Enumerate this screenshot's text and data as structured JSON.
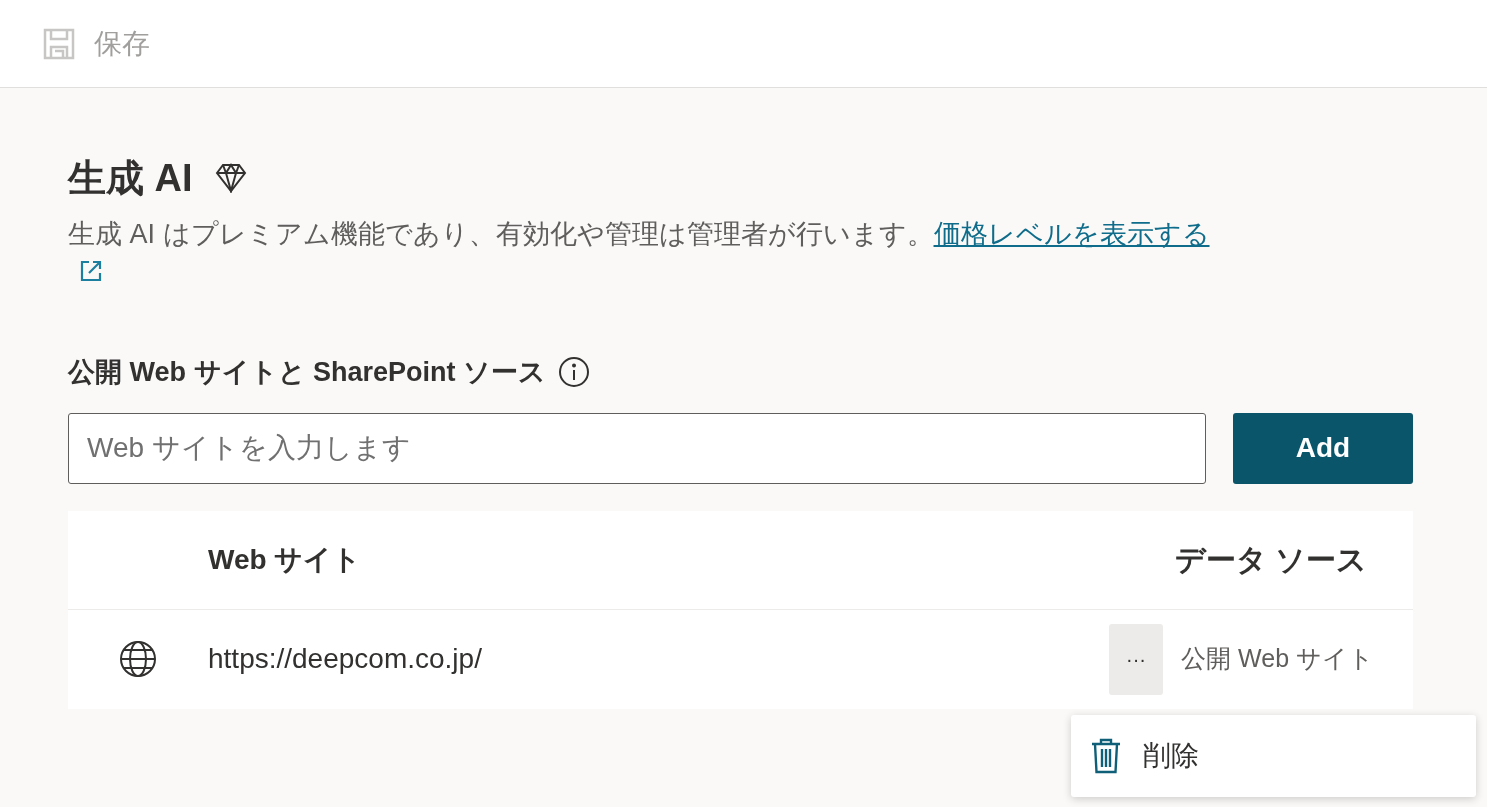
{
  "toolbar": {
    "save": {
      "label": "保存",
      "disabled": true
    }
  },
  "generative_ai": {
    "title": "生成 AI",
    "description": "生成 AI はプレミアム機能であり、有効化や管理は管理者が行います。",
    "link": "価格レベルを表示する"
  },
  "sources": {
    "heading": "公開 Web サイトと SharePoint ソース",
    "input": {
      "placeholder": "Web サイトを入力します"
    },
    "add_button": "Add",
    "table": {
      "columns": [
        "Web サイト",
        "データ ソース"
      ],
      "rows": [
        {
          "url": "https://deepcom.co.jp/",
          "source": "公開 Web サイト",
          "menu_open": true,
          "more": "···"
        }
      ]
    },
    "context_menu": [
      {
        "label": "削除"
      }
    ]
  }
}
